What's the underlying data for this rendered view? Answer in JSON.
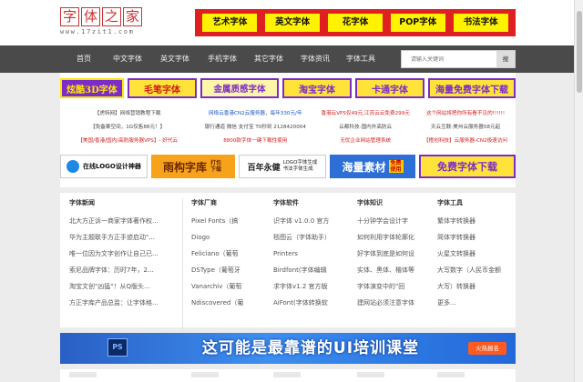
{
  "logo": {
    "chars": [
      "字",
      "体",
      "之",
      "家"
    ],
    "url": "www.17zit1.com"
  },
  "header_links": [
    "艺术字体",
    "英文字体",
    "花字体",
    "POP字体",
    "书法字体"
  ],
  "nav": {
    "items": [
      "首页",
      "中文字体",
      "英文字体",
      "手机字体",
      "其它字体",
      "字体资讯",
      "字体工具"
    ],
    "search_placeholder": "请输入关键词",
    "search_button": "搜"
  },
  "banner_row1": [
    "炫酷3D字体",
    "毛笔字体",
    "金属质感字体",
    "淘宝字体",
    "卡通字体",
    "海量免费字体下载"
  ],
  "ad_text_rows": [
    [
      "【虎特网】网络营销教程下载",
      "网络云香港CN2云服务器，每年330元/年",
      "香港云VPS仅49元,江苏云云免费299元",
      "这个网站将把你所有看不见的!!!!!!"
    ],
    [
      "【免备案空间，1G仅售88元！】",
      "银行通道 微信 支付宝 T0秒到 2128420004",
      "云都科技-国内外高防云",
      "天云互联-美州云服务器58元起"
    ],
    [
      "【美国/香港/国内/高防服务器VPS】- 好代云",
      "8800款字体一键下载性使用",
      "无忧企业网站管理系统",
      "【橙创科技】云服务器-CN2极速访问"
    ]
  ],
  "banner_row2": {
    "logo_design": "在线LOGO设计神器",
    "font_pack": "雨构字库",
    "font_pack_sub": "打包下载",
    "logo_gen_title": "百年永健",
    "logo_gen_sub1": "LOGO字体生成",
    "logo_gen_sub2": "书法字体生成",
    "material": "海量素材",
    "material_badge": "免费使用",
    "free_download": "免费字体下载"
  },
  "columns": [
    {
      "title": "字体新闻",
      "items": [
        "北大方正诉一商家字体著作权...",
        "华为主题联手方正手迹启动\"...",
        "唯一位因为文字创作让自己已...",
        "索尼品牌字体：历时7年，2...",
        "淘宝文创\"凶猛\"！从Q版头...",
        "方正字库产品总监：让字体格..."
      ]
    },
    {
      "title": "字体厂商",
      "items": [
        "Pixel Fonts（搞",
        "Diogo",
        "Feliciano（葡萄",
        "DSType（葡萄牙",
        "Vanarchiv（葡萄",
        "Ndiscovered（葡"
      ]
    },
    {
      "title": "字体软件",
      "items": [
        "识字体 v1.0.0 官方",
        "毯图云（字体助手）",
        "Printers",
        "Birdfont(字体编辑",
        "求字体v1.2 官方版",
        "AiFont(字体转换软"
      ]
    },
    {
      "title": "字体知识",
      "items": [
        "十分钟学会设计字",
        "如何利用字体轮廓化",
        "好字体到底是如何设",
        "实体、黑体、楷体等",
        "字体演变中的\"回",
        "建网站必须注意字体"
      ]
    },
    {
      "title": "字体工具",
      "items": [
        "繁体字转换器",
        "简体字转换器",
        "火星文转换器",
        "大写数字（人民币金额",
        "大写）转换器",
        "更多..."
      ]
    }
  ],
  "bottom_ad": {
    "ps": "PS",
    "title": "这可能是最靠谱的UI培训课堂",
    "button": "火热报名"
  }
}
